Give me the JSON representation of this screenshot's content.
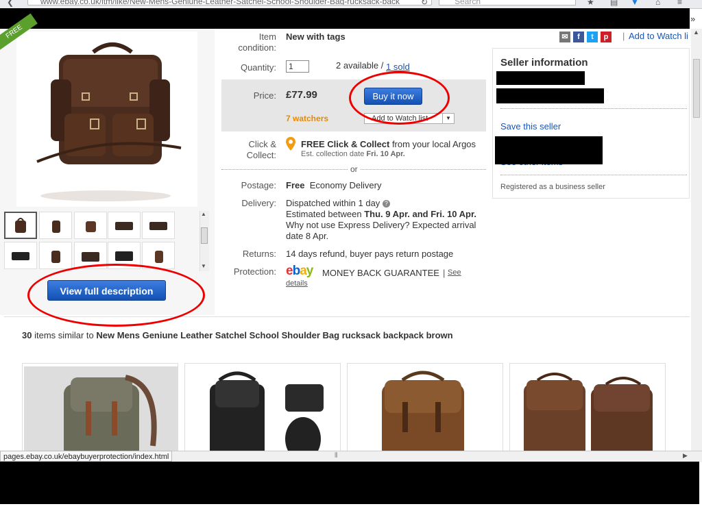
{
  "browser": {
    "url": "www.ebay.co.uk/itm/like/New-Mens-Geniune-Leather-Satchel-School-Shoulder-Bag-rucksack-back",
    "search_placeholder": "Search",
    "status_url": "pages.ebay.co.uk/ebaybuyerprotection/index.html",
    "overflow_glyph": "»"
  },
  "badge": "FREE",
  "item": {
    "condition_label": "Item condition:",
    "condition_value": "New with tags",
    "quantity_label": "Quantity:",
    "quantity_value": "1",
    "available": "2 available /",
    "sold": "1 sold",
    "price_label": "Price:",
    "price": "£77.99",
    "buy_now": "Buy it now",
    "watchers": "7 watchers",
    "add_watch": "Add to Watch list",
    "collect_label": "Click & Collect:",
    "collect_title": "FREE Click & Collect",
    "collect_rest": "from your local Argos",
    "collect_est": "Est. collection date",
    "collect_date": "Fri. 10 Apr.",
    "or": "or",
    "postage_label": "Postage:",
    "postage_free": "Free",
    "postage_type": "Economy Delivery",
    "delivery_label": "Delivery:",
    "delivery_dispatch": "Dispatched within 1 day",
    "delivery_est_prefix": "Estimated between",
    "delivery_est_dates": "Thu. 9 Apr. and Fri. 10 Apr.",
    "delivery_express": "Why not use Express Delivery? Expected arrival",
    "delivery_express2": "date 8 Apr.",
    "returns_label": "Returns:",
    "returns_value": "14 days refund, buyer pays return postage",
    "protection_label": "Protection:",
    "protection_text": "MONEY BACK GUARANTEE",
    "see": "See",
    "details": "details",
    "ebay_logo": [
      "e",
      "b",
      "a",
      "y"
    ]
  },
  "actions": {
    "add_to_watch": "Add to Watch li",
    "pipe": "|"
  },
  "seller": {
    "title": "Seller information",
    "save": "Save this seller",
    "see_other": "See other items",
    "registered": "Registered as a business seller"
  },
  "gallery": {
    "view_full": "View full description"
  },
  "similar": {
    "count": "30",
    "items_similar_to": "items similar to",
    "title": "New Mens Geniune Leather Satchel School Shoulder Bag rucksack backpack brown"
  },
  "colors": {
    "accent": "#1a55b0",
    "watchers": "#e88a00",
    "annotation": "#e00000",
    "badge": "#5ba02c"
  }
}
